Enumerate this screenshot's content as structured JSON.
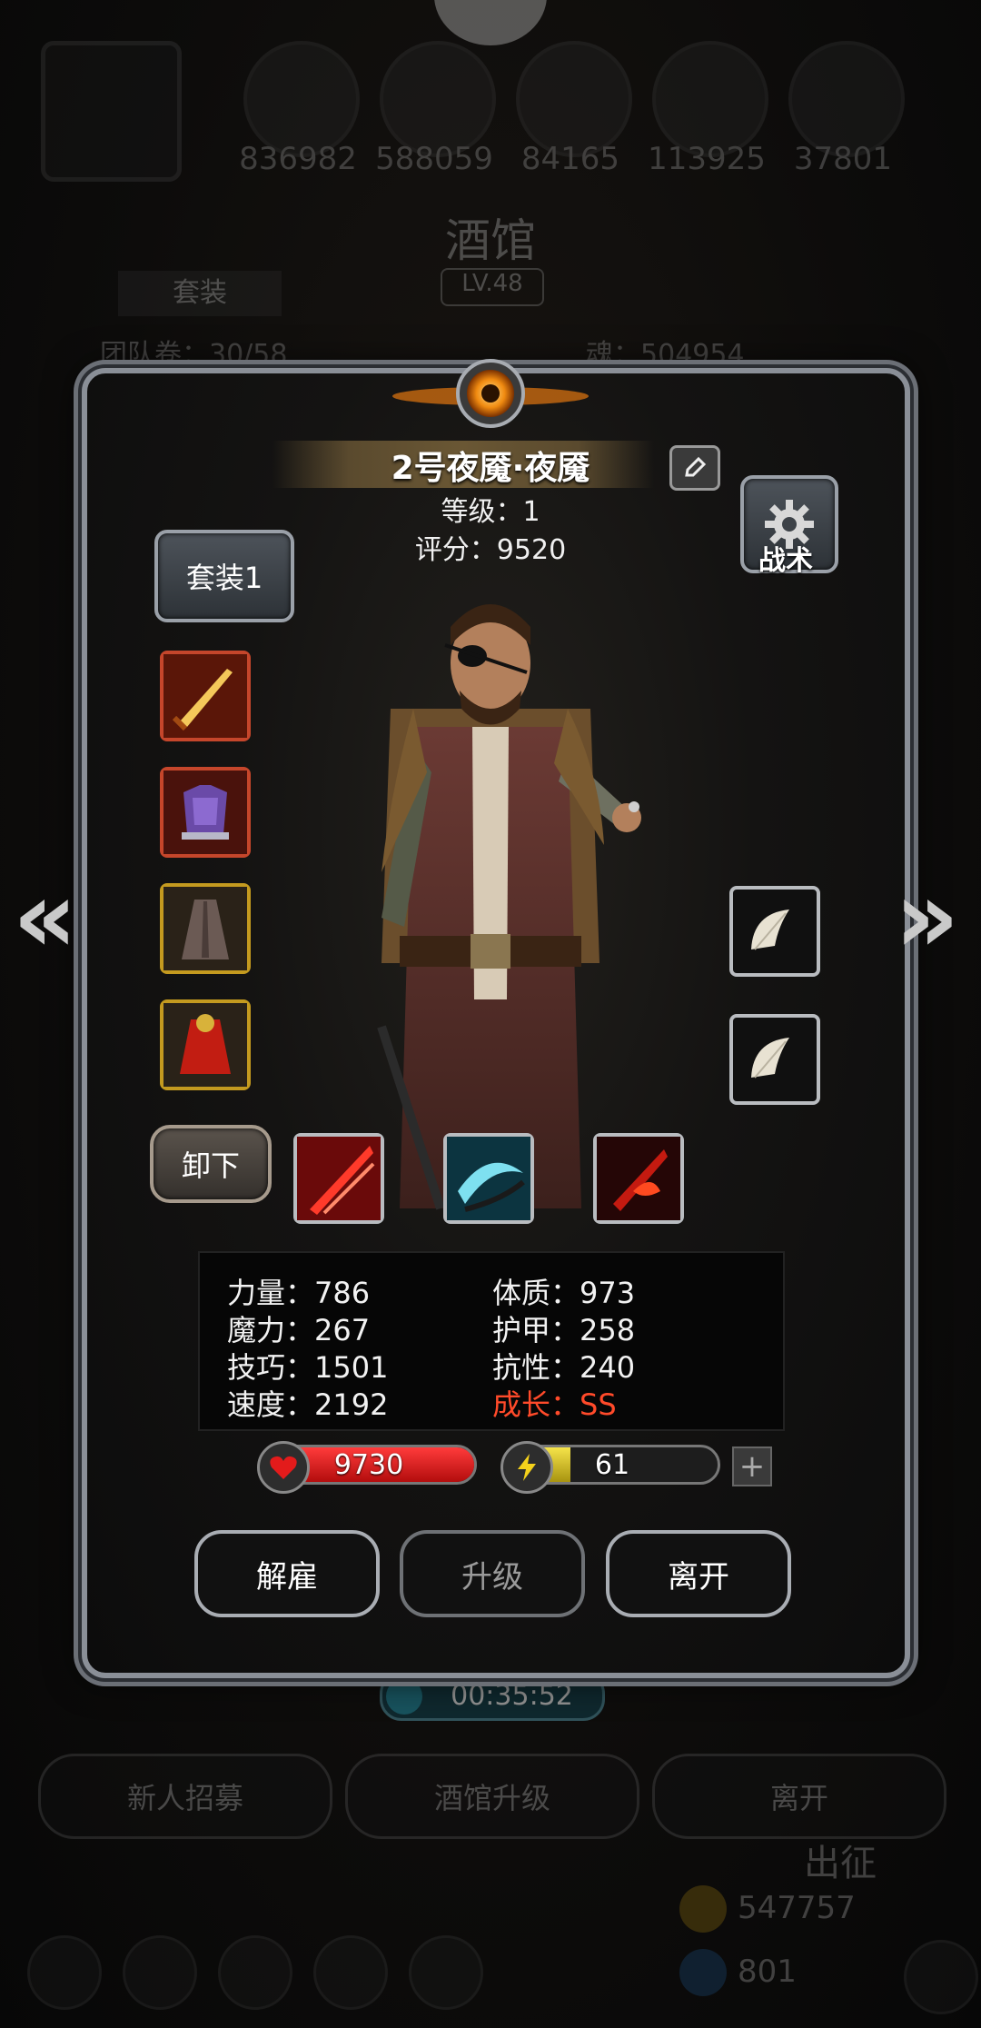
{
  "background": {
    "resources": [
      "836982",
      "588059",
      "84165",
      "113925",
      "37801"
    ],
    "tavern_title": "酒馆",
    "tavern_level": "LV.48",
    "suit_tab": "套装",
    "left_counter": "团队卷：30/58",
    "right_counter": "魂：504954",
    "timer": "00:35:52",
    "buttons": [
      "新人招募",
      "酒馆升级",
      "离开"
    ],
    "expedition": "出征",
    "gold": "547757",
    "gems": "801"
  },
  "modal": {
    "hero_name": "2号夜魇·夜魇",
    "level_text": "等级：1",
    "score_text": "评分：9520",
    "tactics_label": "战术",
    "suit_button": "套装1",
    "unequip_button": "卸下",
    "stats": {
      "strength": "力量：786",
      "constitution": "体质：973",
      "magic": "魔力：267",
      "armor": "护甲：258",
      "skill": "技巧：1501",
      "resistance": "抗性：240",
      "speed": "速度：2192",
      "growth": "成长：SS"
    },
    "hp": "9730",
    "energy": "61",
    "energy_fraction": 0.3,
    "actions": {
      "dismiss": "解雇",
      "upgrade": "升级",
      "leave": "离开"
    }
  },
  "colors": {
    "growth": "#ff4a2a",
    "hp_bar": "#d11616",
    "energy_bar": "#d8c21a"
  }
}
